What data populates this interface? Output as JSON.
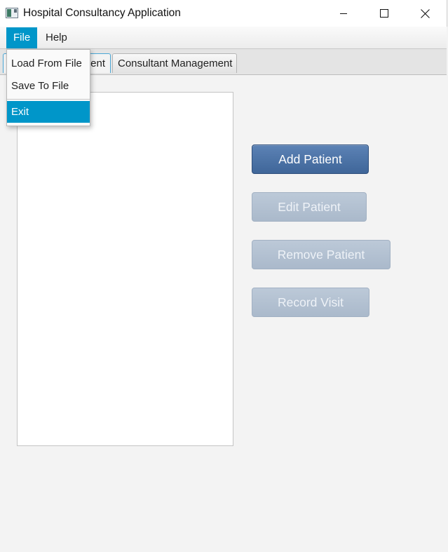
{
  "window": {
    "title": "Hospital Consultancy Application",
    "icons": {
      "app": "app-icon",
      "minimize": "minimize-icon",
      "maximize": "maximize-icon",
      "close": "close-icon"
    }
  },
  "menubar": {
    "file": "File",
    "help": "Help"
  },
  "file_menu": {
    "items": [
      "Load From File",
      "Save To File",
      "Exit"
    ],
    "highlighted": "Exit"
  },
  "tabs": {
    "patient_visible": "ent",
    "consultant": "Consultant Management",
    "selected": "Patient Management"
  },
  "buttons": {
    "add_patient": "Add Patient",
    "edit_patient": "Edit Patient",
    "remove_patient": "Remove Patient",
    "record_visit": "Record Visit"
  },
  "colors": {
    "accent": "#0096c9",
    "primary_button": "#4a70a4",
    "disabled_button": "#b3c1d2"
  }
}
